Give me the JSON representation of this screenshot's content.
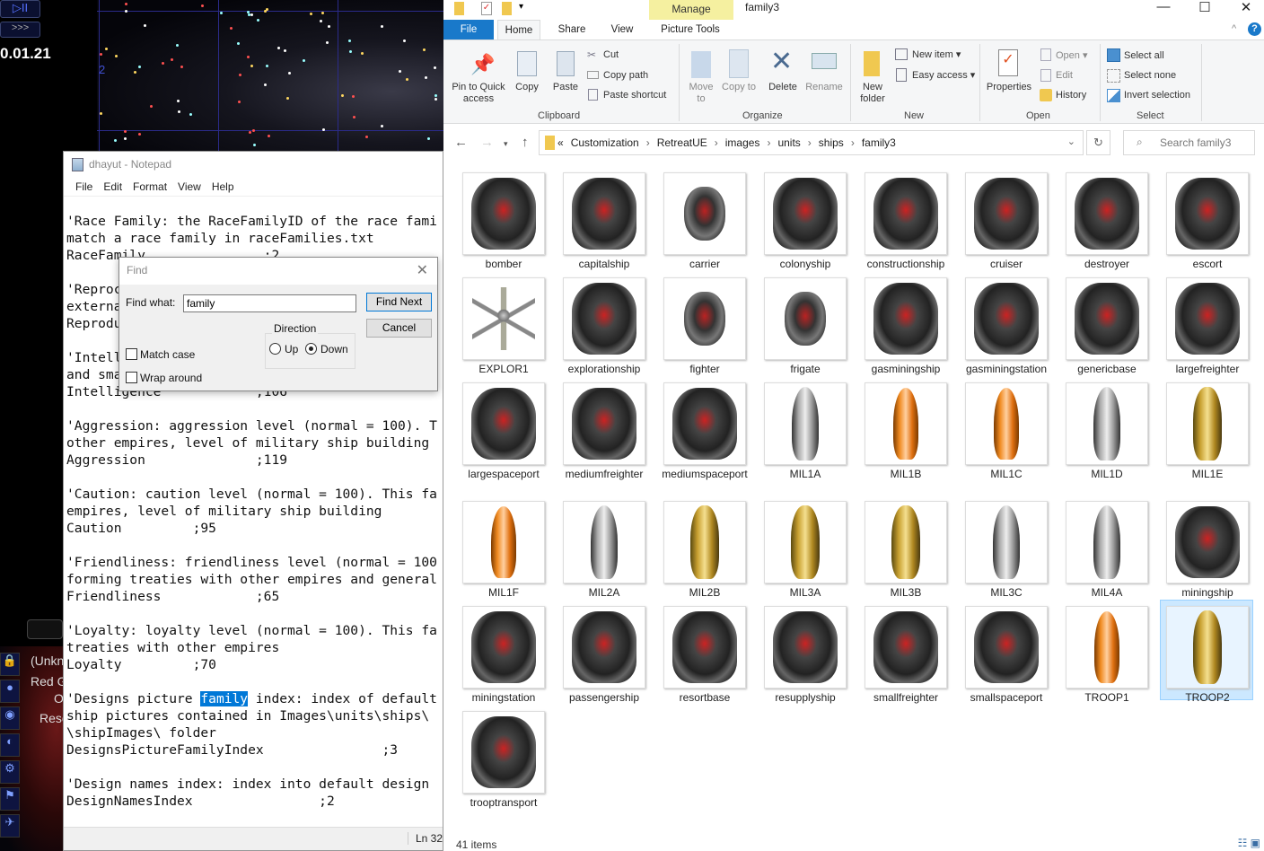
{
  "game": {
    "play_pause_label": "▷II",
    "speed_label": ">>>",
    "time": "0.01.21",
    "map_marker": "2",
    "side_texts": [
      "(Unkn",
      "Red G",
      "O",
      "Reso"
    ]
  },
  "notepad": {
    "title": "dhayut - Notepad",
    "menu": [
      "File",
      "Edit",
      "Format",
      "View",
      "Help"
    ],
    "lines": [
      "'Race Family: the RaceFamilyID of the race fami",
      "match a race family in raceFamilies.txt",
      "RaceFamily               ;2",
      "",
      "'Reproc",
      "externa",
      "Reprodu",
      "",
      "'Intell",
      "and sma",
      "Intelligence            ;106",
      "",
      "'Aggression: aggression level (normal = 100). T",
      "other empires, level of military ship building",
      "Aggression              ;119",
      "",
      "'Caution: caution level (normal = 100). This fa",
      "empires, level of military ship building",
      "Caution         ;95",
      "",
      "'Friendliness: friendliness level (normal = 100",
      "forming treaties with other empires and general",
      "Friendliness            ;65",
      "",
      "'Loyalty: loyalty level (normal = 100). This fa",
      "treaties with other empires",
      "Loyalty         ;70",
      ""
    ],
    "highlight_line": {
      "before": "'Designs picture ",
      "match": "family",
      "after": " index: index of default"
    },
    "lines_after": [
      "ship pictures contained in Images\\units\\ships\\",
      "\\shipImages\\ folder",
      "DesignsPictureFamilyIndex               ;3",
      "",
      "'Design names index: index into default design",
      "DesignNamesIndex                ;2"
    ],
    "status_position": "Ln 32"
  },
  "find_dialog": {
    "title": "Find",
    "find_what_label": "Find what:",
    "find_what_value": "family",
    "find_next_label": "Find Next",
    "cancel_label": "Cancel",
    "direction_label": "Direction",
    "up_label": "Up",
    "down_label": "Down",
    "direction_selected": "Down",
    "match_case_label": "Match case",
    "match_case_checked": false,
    "wrap_around_label": "Wrap around",
    "wrap_around_checked": false
  },
  "explorer": {
    "window_title": "family3",
    "context_tab": "Manage",
    "tabs": [
      "File",
      "Home",
      "Share",
      "View",
      "Picture Tools"
    ],
    "active_tab": "Home",
    "ribbon": {
      "pin": "Pin to Quick access",
      "copy": "Copy",
      "paste": "Paste",
      "cut": "Cut",
      "copy_path": "Copy path",
      "paste_shortcut": "Paste shortcut",
      "move_to": "Move to",
      "copy_to": "Copy to",
      "delete": "Delete",
      "rename": "Rename",
      "new_folder": "New folder",
      "new_item": "New item ▾",
      "easy_access": "Easy access ▾",
      "properties": "Properties",
      "open": "Open ▾",
      "edit": "Edit",
      "history": "History",
      "select_all": "Select all",
      "select_none": "Select none",
      "invert_selection": "Invert selection",
      "groups": [
        "Clipboard",
        "Organize",
        "New",
        "Open",
        "Select"
      ]
    },
    "breadcrumb": [
      "Customization",
      "RetreatUE",
      "images",
      "units",
      "ships",
      "family3"
    ],
    "search_placeholder": "Search family3",
    "files": [
      {
        "name": "bomber",
        "style": "hull"
      },
      {
        "name": "capitalship",
        "style": "hull"
      },
      {
        "name": "carrier",
        "style": "small"
      },
      {
        "name": "colonyship",
        "style": "hull"
      },
      {
        "name": "constructionship",
        "style": "hull"
      },
      {
        "name": "cruiser",
        "style": "hull"
      },
      {
        "name": "destroyer",
        "style": "hull"
      },
      {
        "name": "escort",
        "style": "hull"
      },
      {
        "name": "EXPLOR1",
        "style": "probe"
      },
      {
        "name": "explorationship",
        "style": "hull"
      },
      {
        "name": "fighter",
        "style": "small"
      },
      {
        "name": "frigate",
        "style": "small"
      },
      {
        "name": "gasminingship",
        "style": "hull"
      },
      {
        "name": "gasminingstation",
        "style": "hull"
      },
      {
        "name": "genericbase",
        "style": "hull"
      },
      {
        "name": "largefreighter",
        "style": "hull"
      },
      {
        "name": "largespaceport",
        "style": "hull"
      },
      {
        "name": "mediumfreighter",
        "style": "hull"
      },
      {
        "name": "mediumspaceport",
        "style": "hull"
      },
      {
        "name": "MIL1A",
        "style": "silver"
      },
      {
        "name": "MIL1B",
        "style": "orange"
      },
      {
        "name": "MIL1C",
        "style": "orange"
      },
      {
        "name": "MIL1D",
        "style": "silver"
      },
      {
        "name": "MIL1E",
        "style": "gold"
      },
      {
        "name": "MIL1F",
        "style": "orange"
      },
      {
        "name": "MIL2A",
        "style": "silver"
      },
      {
        "name": "MIL2B",
        "style": "gold"
      },
      {
        "name": "MIL3A",
        "style": "gold"
      },
      {
        "name": "MIL3B",
        "style": "gold"
      },
      {
        "name": "MIL3C",
        "style": "silver"
      },
      {
        "name": "MIL4A",
        "style": "silver"
      },
      {
        "name": "miningship",
        "style": "hull"
      },
      {
        "name": "miningstation",
        "style": "hull"
      },
      {
        "name": "passengership",
        "style": "hull"
      },
      {
        "name": "resortbase",
        "style": "hull"
      },
      {
        "name": "resupplyship",
        "style": "hull"
      },
      {
        "name": "smallfreighter",
        "style": "hull"
      },
      {
        "name": "smallspaceport",
        "style": "hull"
      },
      {
        "name": "TROOP1",
        "style": "orange"
      },
      {
        "name": "TROOP2",
        "style": "gold",
        "selected": true
      },
      {
        "name": "trooptransport",
        "style": "hull"
      }
    ],
    "status_count": "41 items",
    "selection_color": "#cce8ff",
    "file_tab_color": "#1979ca"
  }
}
